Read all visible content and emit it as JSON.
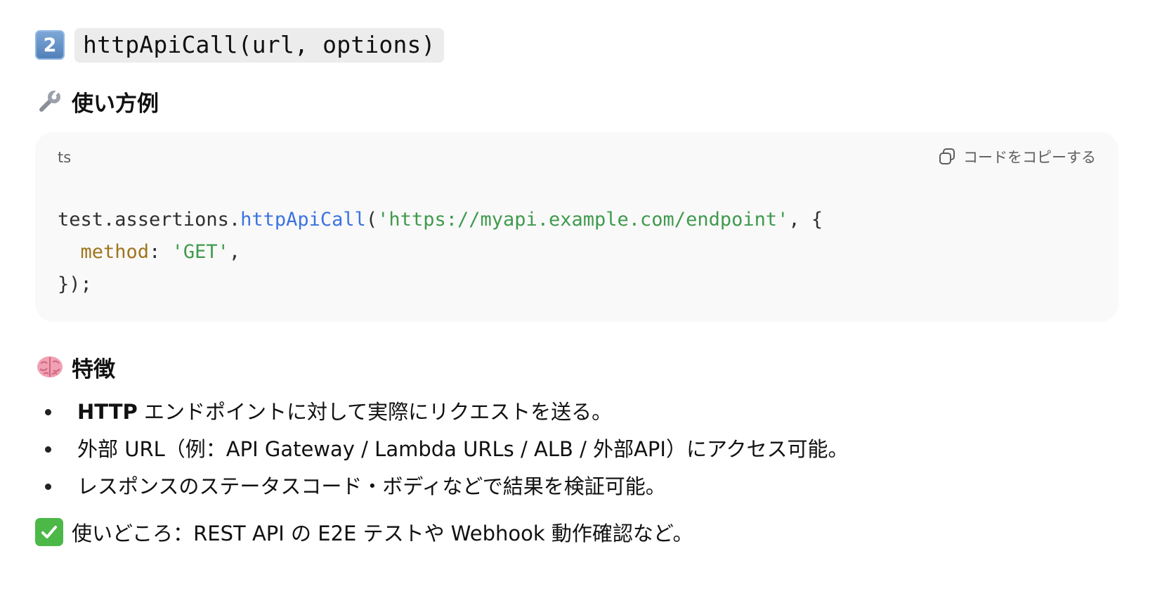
{
  "function_heading": {
    "number_badge": "2",
    "signature": "httpApiCall(url, options)"
  },
  "usage_section": {
    "icon": "wrench-icon",
    "title": "使い方例"
  },
  "code_block": {
    "language": "ts",
    "copy_label": "コードをコピーする",
    "line1": {
      "object": "test.assertions.",
      "method": "httpApiCall",
      "open_paren": "(",
      "url_string": "'https://myapi.example.com/endpoint'",
      "rest": ", {"
    },
    "line2": {
      "indent": "  ",
      "key": "method",
      "colon": ": ",
      "value": "'GET'",
      "comma": ","
    },
    "line3": "});"
  },
  "features_section": {
    "icon": "brain-icon",
    "title": "特徴",
    "items": [
      {
        "bold": "HTTP",
        "text": " エンドポイントに対して実際にリクエストを送る。"
      },
      {
        "bold": "",
        "text": "外部 URL（例：API Gateway / Lambda URLs / ALB / 外部API）にアクセス可能。"
      },
      {
        "bold": "",
        "text": "レスポンスのステータスコード・ボディなどで結果を検証可能。"
      }
    ]
  },
  "summary": {
    "icon": "check-mark-icon",
    "text": "使いどころ：REST API の E2E テストや Webhook 動作確認など。"
  },
  "colors": {
    "function_token": "#3b73e0",
    "string_token": "#3f9a4d",
    "property_token": "#a0741d",
    "code_background": "#f9f9f9",
    "inline_code_background": "#ececec",
    "check_green": "#4cb848"
  }
}
